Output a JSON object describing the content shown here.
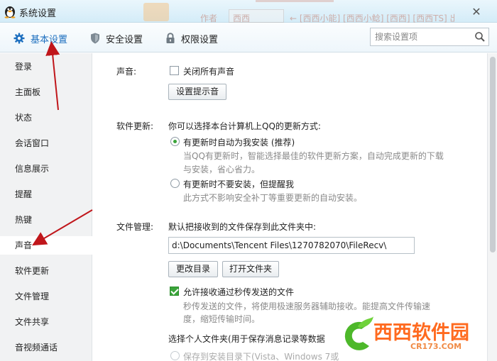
{
  "window": {
    "title": "系统设置",
    "close_glyph": "✕",
    "background_snippets": [
      "作者",
      "西西",
      "← [西西小能] [西西小鲶] [西西] [西西TS] 出处："
    ]
  },
  "tabs": [
    {
      "label": "基本设置",
      "icon": "gear-icon",
      "active": true
    },
    {
      "label": "安全设置",
      "icon": "shield-icon",
      "active": false
    },
    {
      "label": "权限设置",
      "icon": "lock-icon",
      "active": false
    }
  ],
  "search": {
    "placeholder": "搜索设置项",
    "icon": "search-icon"
  },
  "sidebar": {
    "items": [
      {
        "label": "登录"
      },
      {
        "label": "主面板"
      },
      {
        "label": "状态"
      },
      {
        "label": "会话窗口"
      },
      {
        "label": "信息展示"
      },
      {
        "label": "提醒"
      },
      {
        "label": "热键"
      },
      {
        "label": "声音",
        "active": true
      },
      {
        "label": "软件更新"
      },
      {
        "label": "文件管理"
      },
      {
        "label": "文件共享"
      },
      {
        "label": "音视频通话"
      }
    ]
  },
  "sound": {
    "label": "声音:",
    "mute_all": {
      "label": "关闭所有声音",
      "checked": false
    },
    "prompt_button": "设置提示音"
  },
  "update": {
    "label": "软件更新:",
    "intro": "你可以选择本台计算机上QQ的更新方式:",
    "options": [
      {
        "label": "有更新时自动为我安装 (推荐)",
        "selected": true,
        "desc1": "当QQ有更新时，智能选择最佳的软件更新方案，自动完成更新的下载",
        "desc2": "与安装，省心省力。"
      },
      {
        "label": "有更新时不要安装，但提醒我",
        "selected": false,
        "desc1": "此方式不影响安全补丁等重要更新的自动安装。"
      }
    ]
  },
  "files": {
    "label": "文件管理:",
    "intro": "默认把接收到的文件保存到此文件夹中:",
    "path": "d:\\Documents\\Tencent Files\\1270782070\\FileRecv\\",
    "change_button": "更改目录",
    "open_button": "打开文件夹",
    "allow_fast": {
      "label": "允许接收通过秒传发送的文件",
      "checked": true
    },
    "fast_desc1": "秒传发送的文件，将使用极速服务器辅助接收。能提高文件传输速",
    "fast_desc2": "度，缩短传输时间。",
    "personal_folder": "选择个人文件夹(用于保存消息记录等数据",
    "save_to_install": "保存到安装目录下(Vista、Windows 7或"
  },
  "watermark": {
    "text": "西西软件园",
    "sub": "CR173.COM"
  },
  "colors": {
    "accent": "#1d6fbf",
    "check": "#3aa43a",
    "arrow": "#c0161b"
  }
}
